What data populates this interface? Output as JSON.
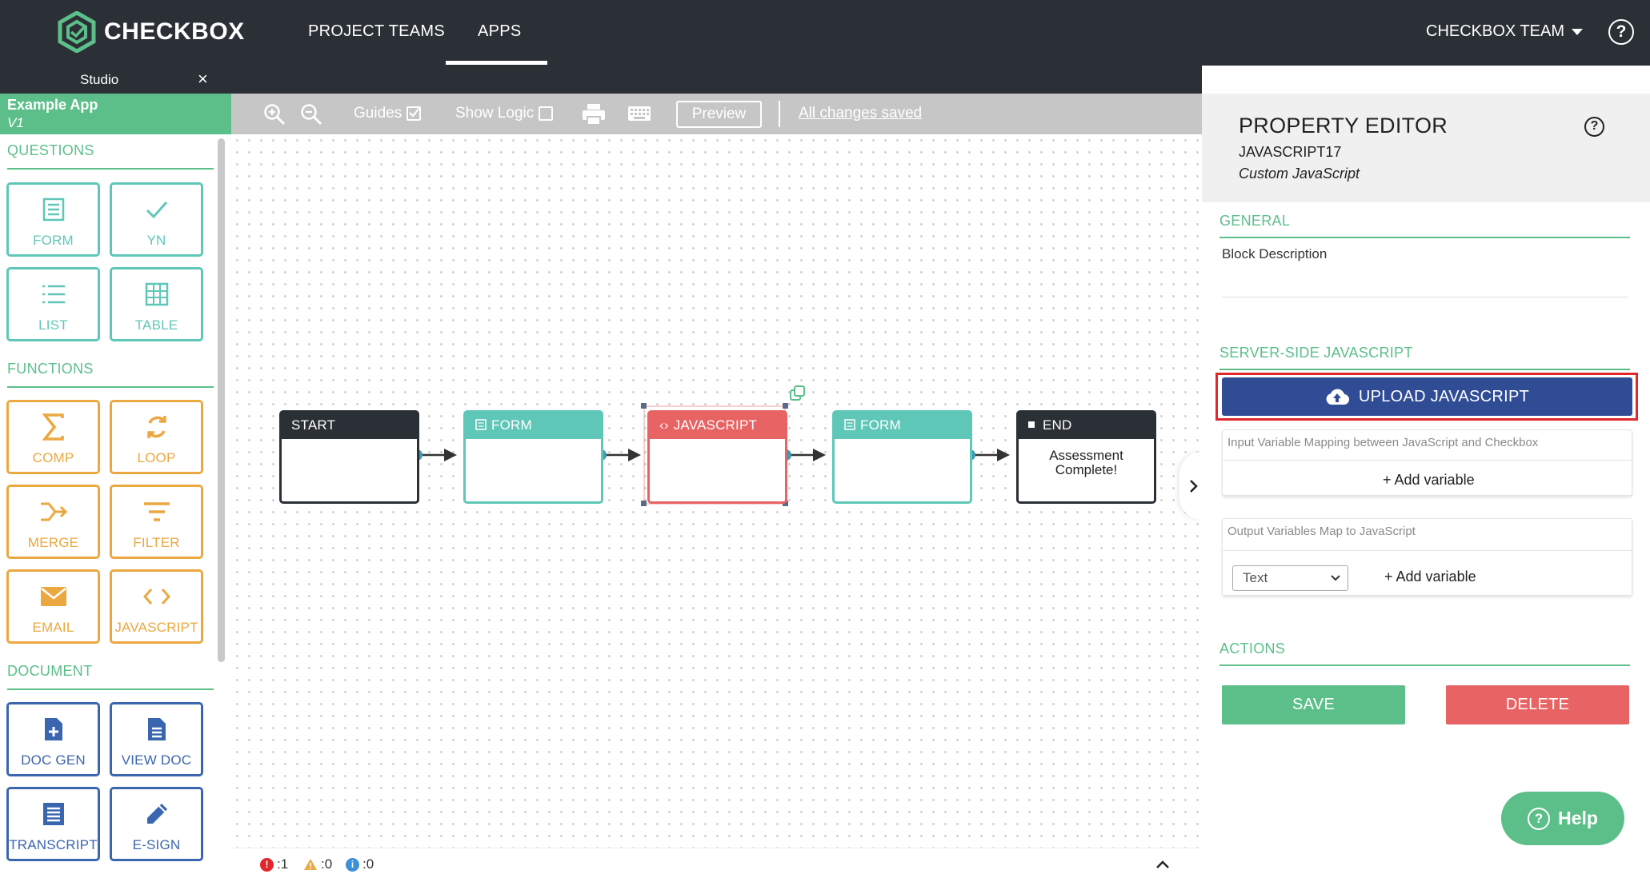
{
  "nav": {
    "brand": "CHECKBOX",
    "links": [
      "PROJECT TEAMS",
      "APPS"
    ],
    "active_link": "APPS",
    "team": "CHECKBOX TEAM",
    "help_glyph": "?"
  },
  "studio": {
    "tab_label": "Studio",
    "close_glyph": "×"
  },
  "sidebar": {
    "app_name": "Example App",
    "app_version": "V1",
    "sections": [
      {
        "title": "QUESTIONS",
        "items": [
          "FORM",
          "YN",
          "LIST",
          "TABLE"
        ]
      },
      {
        "title": "FUNCTIONS",
        "items": [
          "COMP",
          "LOOP",
          "MERGE",
          "FILTER",
          "EMAIL",
          "JAVASCRIPT"
        ]
      },
      {
        "title": "DOCUMENT",
        "items": [
          "DOC GEN",
          "VIEW DOC",
          "TRANSCRIPT",
          "E-SIGN"
        ]
      }
    ]
  },
  "toolbar": {
    "guides_label": "Guides",
    "guides_checked": true,
    "show_logic_label": "Show Logic",
    "show_logic_checked": false,
    "preview_label": "Preview",
    "save_status": "All changes saved"
  },
  "canvas": {
    "nodes": [
      {
        "type": "start",
        "header": "START",
        "body": ""
      },
      {
        "type": "form",
        "header": "FORM",
        "body": ""
      },
      {
        "type": "javascript",
        "header": "JAVASCRIPT",
        "body": "",
        "selected": true
      },
      {
        "type": "form",
        "header": "FORM",
        "body": ""
      },
      {
        "type": "end",
        "header": "END",
        "body_lines": [
          "Assessment",
          "Complete!"
        ]
      }
    ]
  },
  "status": {
    "errors": ":1",
    "warnings": ":0",
    "info": ":0"
  },
  "editor": {
    "title": "PROPERTY EDITOR",
    "block_id": "JAVASCRIPT17",
    "block_type": "Custom JavaScript",
    "general_title": "GENERAL",
    "block_description_label": "Block Description",
    "server_js_title": "SERVER-SIDE JAVASCRIPT",
    "upload_label": "UPLOAD JAVASCRIPT",
    "input_mapping_caption": "Input Variable Mapping between JavaScript and Checkbox",
    "add_variable_label": "+ Add variable",
    "output_mapping_caption": "Output Variables Map to JavaScript",
    "type_select_value": "Text",
    "actions_title": "ACTIONS",
    "save_label": "SAVE",
    "delete_label": "DELETE"
  },
  "help_button_label": "Help",
  "colors": {
    "nav_bg": "#2b3036",
    "green": "#5cbf8a",
    "teal": "#5fc7b8",
    "orange": "#eba840",
    "blue": "#3a66b0",
    "red": "#e86363",
    "upload_blue": "#2f4c95",
    "highlight_red": "#e0282c"
  }
}
